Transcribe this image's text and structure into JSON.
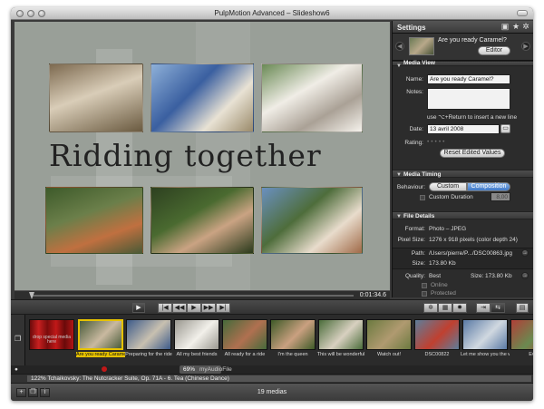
{
  "window": {
    "title": "PulpMotion Advanced – Slideshow6"
  },
  "slide": {
    "title_text": "Ridding together"
  },
  "preview": {
    "timecode": "0:01:34.6"
  },
  "settings": {
    "header": "Settings",
    "nav": {
      "name": "Are you ready Caramel?",
      "editor_button": "Editor"
    },
    "media_view": {
      "section": "Media View",
      "name_label": "Name:",
      "name_value": "Are you ready Caramel?",
      "notes_label": "Notes:",
      "notes_hint": "use ⌥+Return to insert a new line",
      "date_label": "Date:",
      "date_value": "13 avril 2008",
      "rating_label": "Rating:",
      "reset_button": "Reset Edited Values"
    },
    "media_timing": {
      "section": "Media Timing",
      "behaviour_label": "Behaviour:",
      "seg_custom": "Custom",
      "seg_composition": "Composition",
      "custom_duration_label": "Custom Duration",
      "duration_value": "8,00"
    },
    "file_details": {
      "section": "File Details",
      "format_label": "Format:",
      "format_value": "Photo – JPEG",
      "pixel_size_label": "Pixel Size:",
      "pixel_size_value": "1276 x 918 pixels (color depth 24)",
      "path_label": "Path:",
      "path_value": "/Users/pierre/P.../DSC00863.jpg",
      "size_label": "Size:",
      "size_value": "173.80 Kb",
      "quality_label": "Quality:",
      "quality_value": "Best",
      "quality_size_label": "Size:",
      "quality_size_value": "173.80 Kb",
      "online_label": "Online",
      "protected_label": "Protected"
    }
  },
  "strip": {
    "mask_caption": "drop special media here",
    "items": [
      {
        "caption": "Are you ready Caramel?",
        "selected": true,
        "colors": [
          "#4a5c3a",
          "#c9b9a0"
        ]
      },
      {
        "caption": "Preparing for the ride",
        "selected": false,
        "colors": [
          "#3d5b8a",
          "#c8c0b0"
        ]
      },
      {
        "caption": "All my best friends",
        "selected": false,
        "colors": [
          "#9a9890",
          "#f2f0ea"
        ]
      },
      {
        "caption": "All ready for a ride",
        "selected": false,
        "colors": [
          "#466a3b",
          "#b07050"
        ]
      },
      {
        "caption": "I'm the queen",
        "selected": false,
        "colors": [
          "#3e5a28",
          "#caa080"
        ]
      },
      {
        "caption": "This will be wonderful",
        "selected": false,
        "colors": [
          "#4b6d3b",
          "#d8d0c0"
        ]
      },
      {
        "caption": "Watch out!",
        "selected": false,
        "colors": [
          "#6c7a40",
          "#b09a70"
        ]
      },
      {
        "caption": "DSC00822",
        "selected": false,
        "colors": [
          "#5d7d9a",
          "#c04030"
        ]
      },
      {
        "caption": "Let me show you the way",
        "selected": false,
        "colors": [
          "#5a7aa5",
          "#d0d8e0"
        ]
      },
      {
        "caption": "Eve",
        "selected": false,
        "colors": [
          "#b04038",
          "#6a8a50"
        ]
      }
    ]
  },
  "audio": {
    "volume_badge": "69%",
    "track_name": "myAudioFile",
    "music_line": "122% Tchaikovsky: The Nutcracker Suite, Op. 71A - 6. Tea (Chinese Dance)"
  },
  "status": {
    "count": "19 medias"
  }
}
